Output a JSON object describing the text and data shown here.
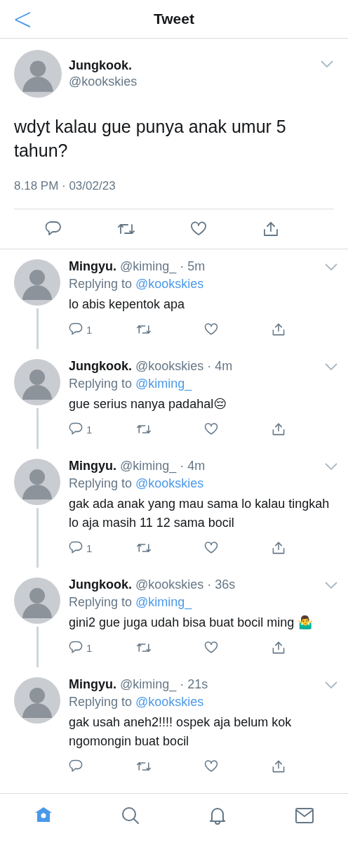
{
  "header": {
    "back": "<",
    "title": "Tweet"
  },
  "tweet": {
    "name": "Jungkook.",
    "handle": "@kookskies",
    "text": "wdyt kalau gue punya anak umur 5 tahun?",
    "timestamp": "8.18 PM · 03/02/23"
  },
  "replies": [
    {
      "name": "Mingyu.",
      "meta": "@kiming_ · 5m",
      "replying_prefix": "Replying to",
      "replying_to": "@kookskies",
      "text": "lo abis kepentok apa",
      "reply_count": "1",
      "connected": true
    },
    {
      "name": "Jungkook.",
      "meta": "@kookskies · 4m",
      "replying_prefix": "Replying to",
      "replying_to": "@kiming_",
      "text": "gue serius nanya padahal😔",
      "reply_count": "1",
      "connected": true
    },
    {
      "name": "Mingyu.",
      "meta": "@kiming_ · 4m",
      "replying_prefix": "Replying to",
      "replying_to": "@kookskies",
      "text": "gak ada anak yang mau sama lo kalau tingkah lo aja masih 11 12 sama bocil",
      "reply_count": "1",
      "connected": true
    },
    {
      "name": "Jungkook.",
      "meta": "@kookskies · 36s",
      "replying_prefix": "Replying to",
      "replying_to": "@kiming_",
      "text": "gini2 gue juga udah bisa buat bocil ming 🤷‍♂️",
      "reply_count": "1",
      "connected": true
    },
    {
      "name": "Mingyu.",
      "meta": "@kiming_ · 21s",
      "replying_prefix": "Replying to",
      "replying_to": "@kookskies",
      "text": "gak usah aneh2!!!! ospek aja belum kok ngomongin buat bocil",
      "connected": false
    }
  ],
  "tab_bar": [
    {
      "kind": "home",
      "selected": true
    },
    {
      "kind": "search",
      "selected": false
    },
    {
      "kind": "notifications",
      "selected": false
    },
    {
      "kind": "messages",
      "selected": false
    }
  ]
}
